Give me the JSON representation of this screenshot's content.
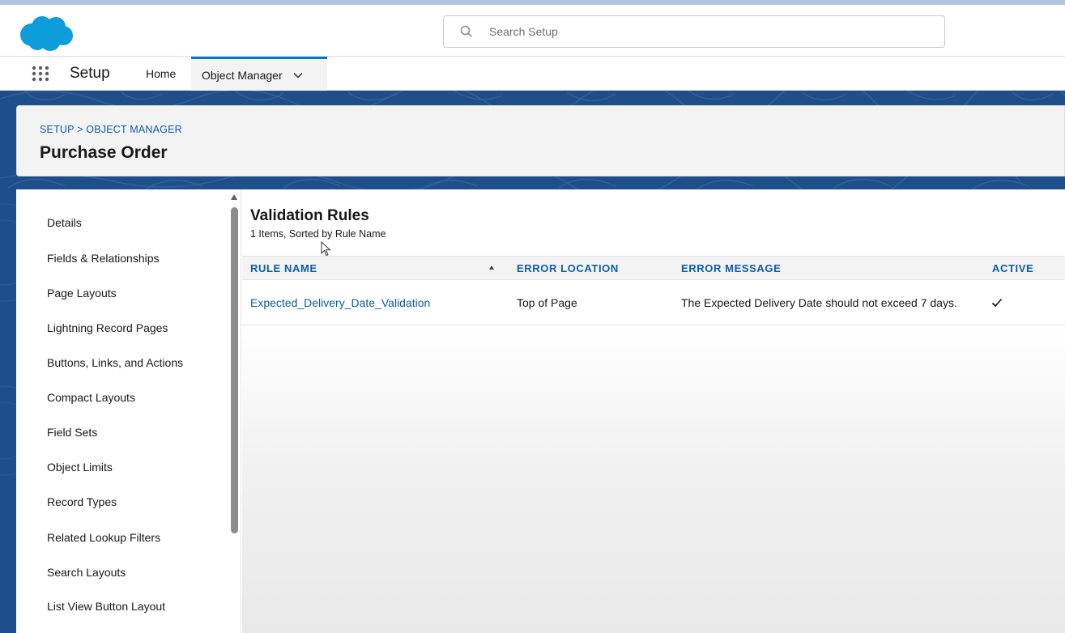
{
  "header": {
    "logo_icon": "salesforce-cloud-logo",
    "search": {
      "icon": "search-icon",
      "placeholder": "Search Setup"
    }
  },
  "nav": {
    "launcher_icon": "app-launcher-icon",
    "app_name": "Setup",
    "tabs": [
      {
        "label": "Home"
      },
      {
        "label": "Object Manager",
        "active": true,
        "icon": "chevron-down-icon"
      }
    ]
  },
  "page_header": {
    "breadcrumb": "SETUP > OBJECT MANAGER",
    "title": "Purchase Order"
  },
  "sidebar": {
    "items": [
      {
        "label": "Details"
      },
      {
        "label": "Fields & Relationships"
      },
      {
        "label": "Page Layouts"
      },
      {
        "label": "Lightning Record Pages"
      },
      {
        "label": "Buttons, Links, and Actions"
      },
      {
        "label": "Compact Layouts"
      },
      {
        "label": "Field Sets"
      },
      {
        "label": "Object Limits"
      },
      {
        "label": "Record Types"
      },
      {
        "label": "Related Lookup Filters"
      },
      {
        "label": "Search Layouts"
      },
      {
        "label": "List View Button Layout"
      }
    ]
  },
  "main": {
    "title": "Validation Rules",
    "subtitle": "1 Items, Sorted by Rule Name",
    "table": {
      "columns": [
        "RULE NAME",
        "ERROR LOCATION",
        "ERROR MESSAGE",
        "ACTIVE"
      ],
      "sort_icon": "sort-ascending-icon",
      "rows": [
        {
          "rule_name": "Expected_Delivery_Date_Validation",
          "error_location": "Top of Page",
          "error_message": "The Expected Delivery Date should not exceed 7 days.",
          "active": true,
          "active_icon": "checkmark-icon"
        }
      ]
    }
  },
  "colors": {
    "brand_blue": "#0b5cab",
    "banner_blue": "#1f4f8a",
    "logo_blue": "#0d9dda",
    "active_tab_border": "#0176d3"
  }
}
